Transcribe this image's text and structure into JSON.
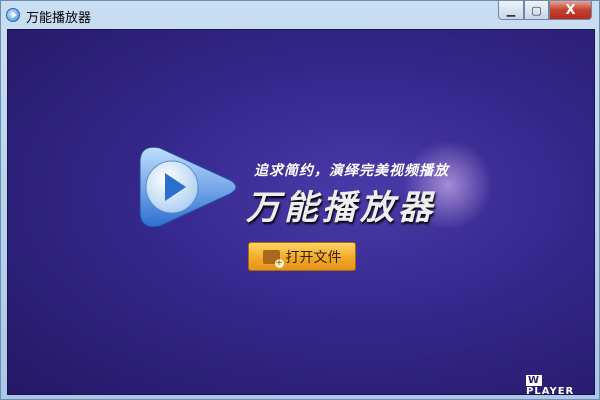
{
  "window": {
    "title": "万能播放器",
    "minimize": "▁",
    "maximize": "▢",
    "close": "X"
  },
  "main": {
    "slogan": "追求简约，演绎完美视频播放",
    "product_name": "万能播放器",
    "open_file_button": "打开文件",
    "brand_letter": "W",
    "brand_text": "PLAYER"
  },
  "colors": {
    "background": "#35278a",
    "button": "#f2a92a"
  }
}
